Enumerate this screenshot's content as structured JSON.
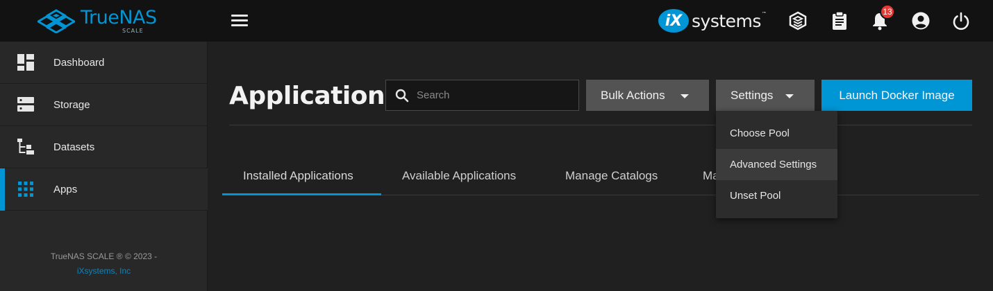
{
  "topbar": {
    "logo_text": "TrueNAS",
    "logo_sub": "SCALE",
    "brand_ix": "iX",
    "brand_text": "systems",
    "brand_tm": "™",
    "notification_count": "13",
    "icons": [
      "truecommand-icon",
      "clipboard-icon",
      "bell-icon",
      "account-icon",
      "power-icon"
    ]
  },
  "sidebar": {
    "items": [
      {
        "label": "Dashboard",
        "icon": "dashboard-icon"
      },
      {
        "label": "Storage",
        "icon": "storage-icon"
      },
      {
        "label": "Datasets",
        "icon": "datasets-icon"
      },
      {
        "label": "Apps",
        "icon": "apps-icon",
        "active": true
      }
    ],
    "footer_line1": "TrueNAS SCALE ® © 2023 -",
    "footer_link": "iXsystems, Inc"
  },
  "main": {
    "title": "Applications",
    "search_placeholder": "Search",
    "bulk_actions_label": "Bulk Actions",
    "settings_label": "Settings",
    "launch_label": "Launch Docker Image",
    "tabs": [
      {
        "label": "Installed Applications",
        "active": true
      },
      {
        "label": "Available Applications"
      },
      {
        "label": "Manage Catalogs"
      },
      {
        "label": "Ma"
      }
    ]
  },
  "settings_menu": {
    "items": [
      {
        "label": "Choose Pool"
      },
      {
        "label": "Advanced Settings",
        "highlighted": true
      },
      {
        "label": "Unset Pool"
      }
    ]
  },
  "colors": {
    "accent": "#0095d5",
    "topbar": "#121212",
    "background": "#202020",
    "sidebar": "#282828",
    "badge": "#e53935"
  }
}
